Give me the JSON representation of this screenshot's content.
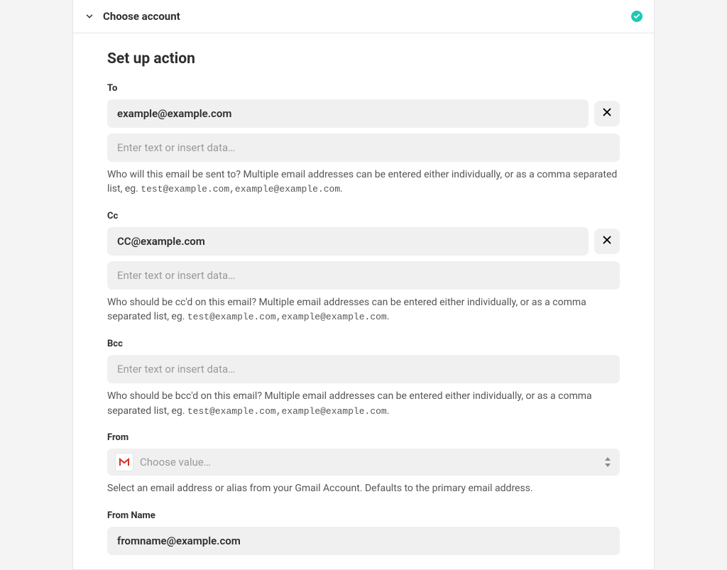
{
  "header": {
    "title": "Choose account"
  },
  "section": {
    "title": "Set up action"
  },
  "fields": {
    "to": {
      "label": "To",
      "chip_value": "example@example.com",
      "placeholder": "Enter text or insert data…",
      "help_pre": "Who will this email be sent to? Multiple email addresses can be entered either individually, or as a comma separated list, eg. ",
      "help_code": "test@example.com,example@example.com",
      "help_post": "."
    },
    "cc": {
      "label": "Cc",
      "chip_value": "CC@example.com",
      "placeholder": "Enter text or insert data…",
      "help_pre": "Who should be cc'd on this email? Multiple email addresses can be entered either individually, or as a comma separated list, eg. ",
      "help_code": "test@example.com,example@example.com",
      "help_post": "."
    },
    "bcc": {
      "label": "Bcc",
      "placeholder": "Enter text or insert data…",
      "help_pre": "Who should be bcc'd on this email? Multiple email addresses can be entered either individually, or as a comma separated list, eg. ",
      "help_code": "test@example.com,example@example.com",
      "help_post": "."
    },
    "from": {
      "label": "From",
      "placeholder": "Choose value…",
      "help": "Select an email address or alias from your Gmail Account. Defaults to the primary email address."
    },
    "from_name": {
      "label": "From Name",
      "value": "fromname@example.com"
    }
  }
}
